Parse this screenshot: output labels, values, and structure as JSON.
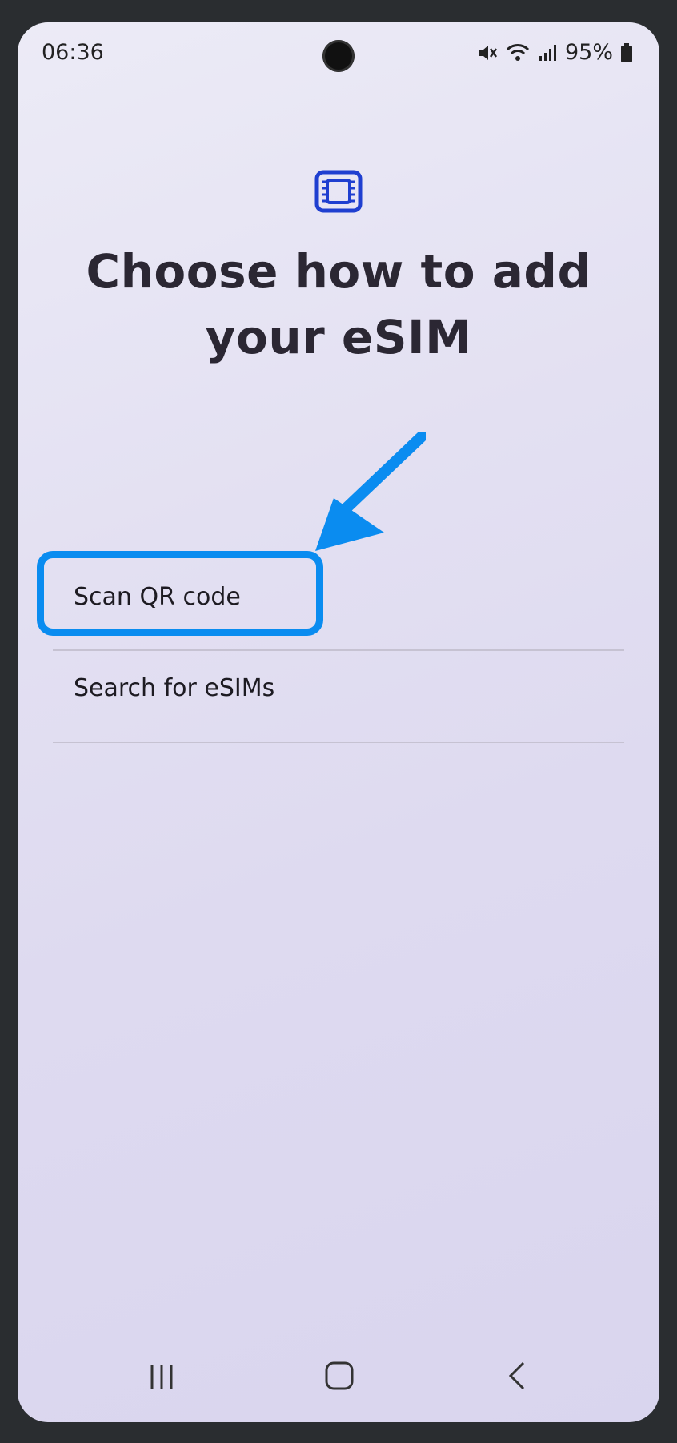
{
  "status_bar": {
    "time": "06:36",
    "battery_percent": "95%",
    "icons": [
      "mute-icon",
      "wifi-icon",
      "signal-icon",
      "battery-icon"
    ]
  },
  "header": {
    "icon": "sim-card-icon",
    "title": "Choose how to add your eSIM"
  },
  "options": [
    {
      "label": "Scan QR code"
    },
    {
      "label": "Search for eSIMs"
    }
  ],
  "annotation": {
    "arrow_color": "#0a8cf0",
    "highlight_color": "#0a8cf0"
  },
  "navigation_bar": {
    "buttons": [
      "recent-apps-icon",
      "home-icon",
      "back-icon"
    ]
  },
  "colors": {
    "accent": "#1f3fd0",
    "text": "#2b2733"
  }
}
